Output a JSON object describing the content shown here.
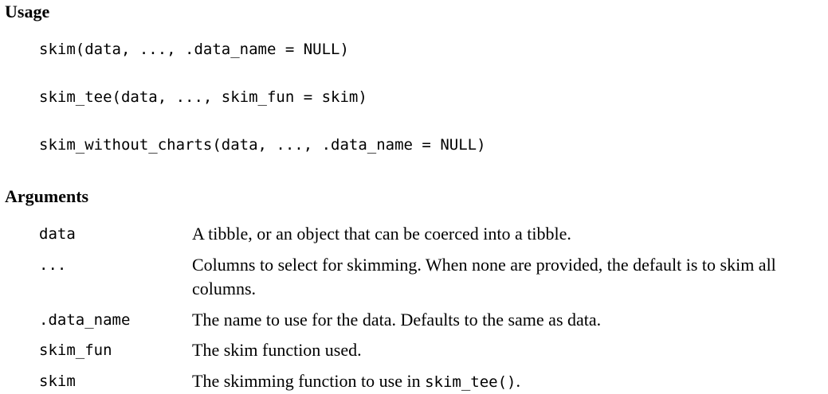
{
  "usage": {
    "heading": "Usage",
    "lines": [
      "skim(data, ..., .data_name = NULL)",
      "skim_tee(data, ..., skim_fun = skim)",
      "skim_without_charts(data, ..., .data_name = NULL)"
    ]
  },
  "arguments": {
    "heading": "Arguments",
    "items": [
      {
        "name": "data",
        "description": "A tibble, or an object that can be coerced into a tibble."
      },
      {
        "name": "...",
        "description": "Columns to select for skimming. When none are provided, the default is to skim all columns."
      },
      {
        "name": ".data_name",
        "description": "The name to use for the data. Defaults to the same as data."
      },
      {
        "name": "skim_fun",
        "description": "The skim function used."
      },
      {
        "name": "skim",
        "description_prefix": "The skimming function to use in ",
        "description_code": "skim_tee()",
        "description_suffix": "."
      }
    ]
  }
}
